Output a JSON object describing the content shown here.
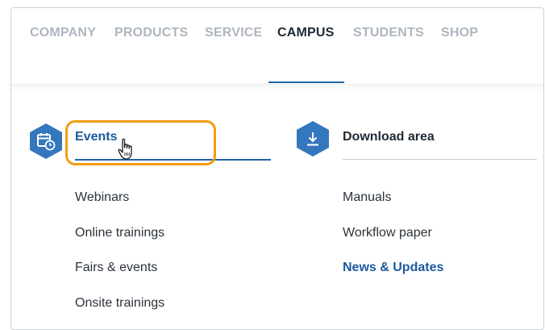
{
  "nav": {
    "items": [
      {
        "label": "COMPANY",
        "active": false
      },
      {
        "label": "PRODUCTS",
        "active": false
      },
      {
        "label": "SERVICE",
        "active": false
      },
      {
        "label": "CAMPUS",
        "active": true
      },
      {
        "label": "STUDENTS",
        "active": false
      },
      {
        "label": "SHOP",
        "active": false
      }
    ]
  },
  "columns": {
    "events": {
      "title": "Events",
      "icon": "calendar-clock-icon",
      "links": [
        "Webinars",
        "Online trainings",
        "Fairs & events",
        "Onsite trainings"
      ]
    },
    "downloads": {
      "title": "Download area",
      "icon": "download-icon",
      "links": [
        "Manuals",
        "Workflow paper",
        "News & Updates"
      ],
      "highlighted_link": "News & Updates"
    }
  },
  "cursor": "hand-pointer-icon",
  "colors": {
    "accent": "#1e64a8",
    "icon_bg": "#3577bd",
    "highlight_box": "#f29c11",
    "nav_inactive": "#aeb6bf",
    "nav_active": "#1f2933"
  }
}
